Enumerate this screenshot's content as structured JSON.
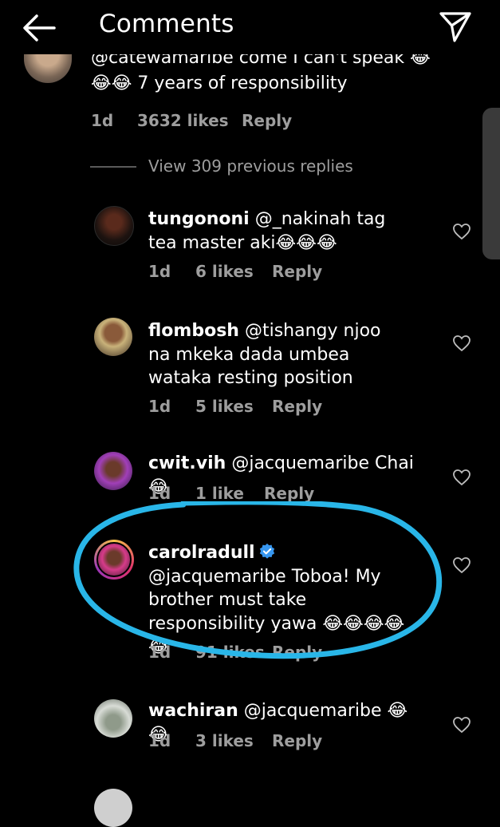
{
  "header": {
    "title": "Comments"
  },
  "top_comment": {
    "text_line1": "@catewamaribe come I can't speak 😂",
    "text_line2": "😂😂 7 years of responsibility",
    "age": "1d",
    "likes": "3632 likes",
    "reply": "Reply"
  },
  "view_replies": "View 309 previous replies",
  "replies": [
    {
      "username": "tungononi",
      "text": "@_nakinah tag tea master aki😂😂😂",
      "age": "1d",
      "likes": "6 likes",
      "reply": "Reply"
    },
    {
      "username": "flombosh",
      "text": "@tishangy njoo na mkeka dada umbea wataka resting position",
      "age": "1d",
      "likes": "5 likes",
      "reply": "Reply"
    },
    {
      "username": "cwit.vih",
      "text": "@jacquemaribe Chai😂",
      "age": "1d",
      "likes": "1 like",
      "reply": "Reply"
    },
    {
      "username": "carolradull",
      "text": "@jacquemaribe Toboa! My brother must take responsibility yawa 😂😂😂😂😂",
      "age": "1d",
      "likes": "91 likes",
      "reply": "Reply"
    },
    {
      "username": "wachiran",
      "text": "@jacquemaribe 😂😂",
      "age": "1d",
      "likes": "3 likes",
      "reply": "Reply"
    }
  ],
  "colors": {
    "background": "#000000",
    "text": "#ffffff",
    "meta": "#9e9e9e",
    "highlight_circle": "#29b6e8",
    "verified_badge": "#3797f0"
  }
}
